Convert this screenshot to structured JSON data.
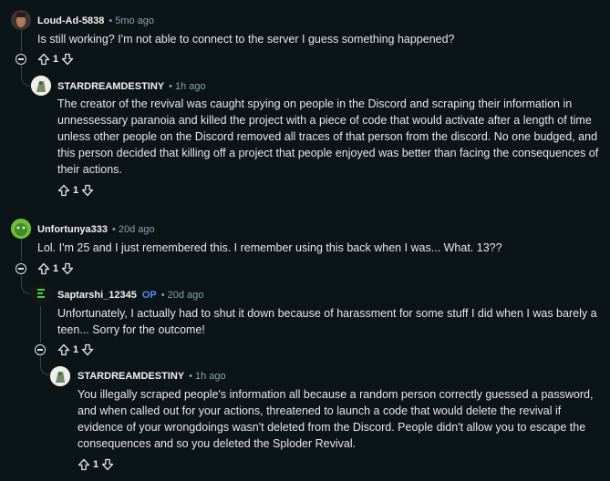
{
  "comments": [
    {
      "author": "Loud-Ad-5838",
      "time": "5mo ago",
      "body": "Is still working? I'm not able to connect to the server I guess something happened?",
      "score": "1"
    },
    {
      "author": "STARDREAMDESTINY",
      "time": "1h ago",
      "body": "The creator of the revival was caught spying on people in the Discord and scraping their information in unnessessary paranoia and killed the project with a piece of code that would activate after a length of time unless other people on the Discord removed all traces of that person from the discord. No one budged, and this person decided that killing off a project that people enjoyed was better than facing the consequences of their actions.",
      "score": "1"
    },
    {
      "author": "Unfortunya333",
      "time": "20d ago",
      "body": "Lol. I'm 25 and I just remembered this. I remember using this back when I was... What. 13??",
      "score": "1"
    },
    {
      "author": "Saptarshi_12345",
      "badge": "OP",
      "time": "20d ago",
      "body": "Unfortunately, I actually had to shut it down because of harassment for some stuff I did when I was barely a teen... Sorry for the outcome!",
      "score": "1"
    },
    {
      "author": "STARDREAMDESTINY",
      "time": "1h ago",
      "body": "You illegally scraped people's information all because a random person correctly guessed a password, and when called out for your actions, threatened to launch a code that would delete the revival if evidence of your wrongdoings wasn't deleted from the Discord. People didn't allow you to escape the consequences and so you deleted the Sploder Revival.",
      "score": "1"
    }
  ],
  "separator": "•"
}
